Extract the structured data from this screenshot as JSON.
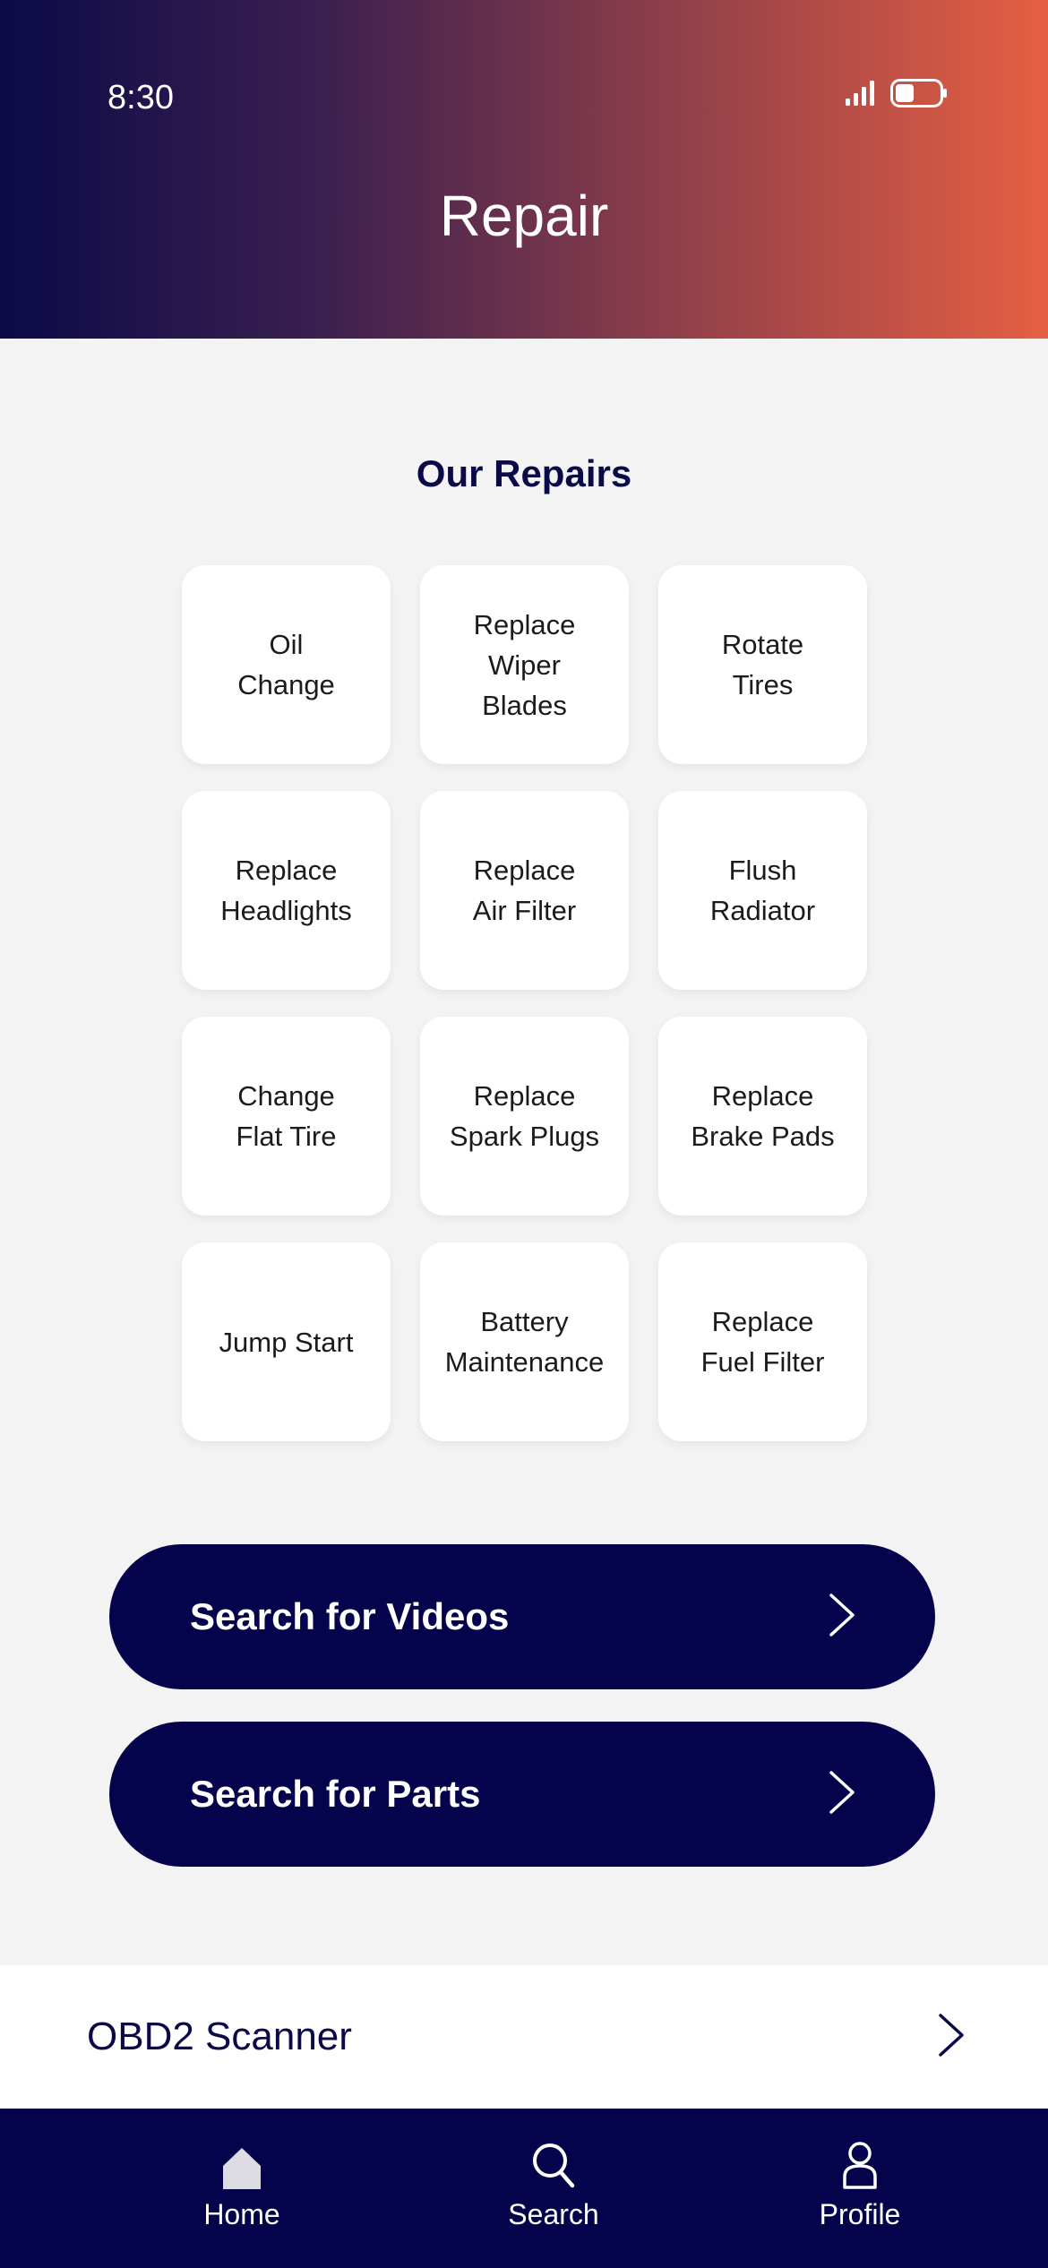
{
  "status_bar": {
    "time": "8:30"
  },
  "header": {
    "title": "Repair"
  },
  "repairs": {
    "title": "Our Repairs",
    "items": [
      {
        "label": "Oil\nChange"
      },
      {
        "label": "Replace\nWiper\nBlades"
      },
      {
        "label": "Rotate\nTires"
      },
      {
        "label": "Replace\nHeadlights"
      },
      {
        "label": "Replace\nAir Filter"
      },
      {
        "label": "Flush\nRadiator"
      },
      {
        "label": "Change\nFlat Tire"
      },
      {
        "label": "Replace\nSpark Plugs"
      },
      {
        "label": "Replace\nBrake Pads"
      },
      {
        "label": "Jump Start"
      },
      {
        "label": "Battery\nMaintenance"
      },
      {
        "label": "Replace\nFuel Filter"
      }
    ]
  },
  "actions": {
    "videos_label": "Search for Videos",
    "parts_label": "Search for Parts"
  },
  "obd": {
    "label": "OBD2 Scanner"
  },
  "tabbar": {
    "home_label": "Home",
    "search_label": "Search",
    "profile_label": "Profile"
  },
  "colors": {
    "navy": "#06034d",
    "gradient_start": "#0b0a48",
    "gradient_end": "#e65f43",
    "background": "#f3f3f4"
  }
}
